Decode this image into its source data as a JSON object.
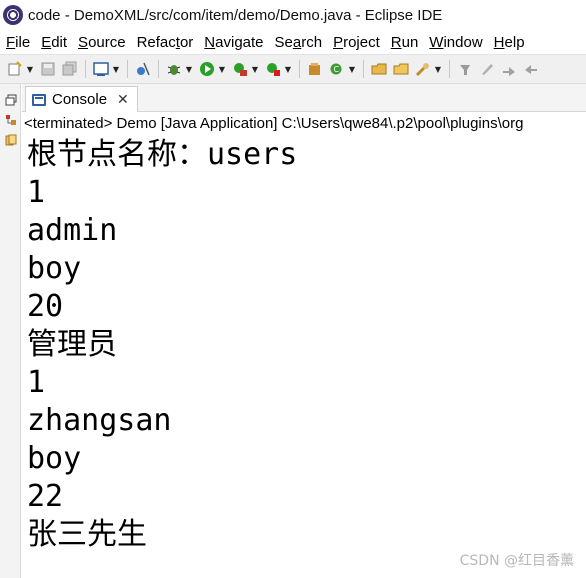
{
  "window": {
    "title": "code - DemoXML/src/com/item/demo/Demo.java - Eclipse IDE"
  },
  "menu": [
    {
      "mnemonic": "F",
      "rest": "ile"
    },
    {
      "mnemonic": "E",
      "rest": "dit"
    },
    {
      "mnemonic": "S",
      "rest": "ource"
    },
    {
      "pre": "Refac",
      "mnemonic": "t",
      "rest": "or"
    },
    {
      "mnemonic": "N",
      "rest": "avigate"
    },
    {
      "pre": "Se",
      "mnemonic": "a",
      "rest": "rch"
    },
    {
      "mnemonic": "P",
      "rest": "roject"
    },
    {
      "mnemonic": "R",
      "rest": "un"
    },
    {
      "mnemonic": "W",
      "rest": "indow"
    },
    {
      "mnemonic": "H",
      "rest": "elp"
    }
  ],
  "console": {
    "tab_label": "Console",
    "status": "<terminated> Demo [Java Application] C:\\Users\\qwe84\\.p2\\pool\\plugins\\org",
    "output_lines": [
      "根节点名称：users",
      "1",
      "admin",
      "boy",
      "20",
      "管理员",
      "1",
      "zhangsan",
      "boy",
      "22",
      "张三先生"
    ]
  },
  "watermark": "CSDN @红目香薰",
  "icons": {
    "app": "eclipse-icon",
    "console": "console-icon",
    "close": "close-icon"
  },
  "colors": {
    "accent": "#2f5f9e",
    "toolbar_bg": "#f0f0f0",
    "run_green": "#2aa02a"
  }
}
